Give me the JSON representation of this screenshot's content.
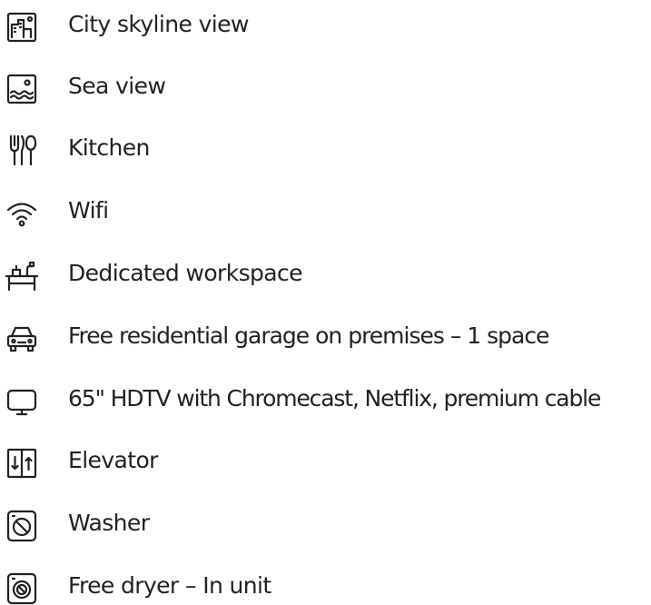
{
  "amenities": [
    {
      "label": "City skyline view",
      "icon": "city-skyline-icon"
    },
    {
      "label": "Sea view",
      "icon": "sea-view-icon"
    },
    {
      "label": "Kitchen",
      "icon": "kitchen-utensils-icon"
    },
    {
      "label": "Wifi",
      "icon": "wifi-icon"
    },
    {
      "label": "Dedicated workspace",
      "icon": "workspace-desk-icon"
    },
    {
      "label": "Free residential garage on premises – 1 space",
      "icon": "car-icon"
    },
    {
      "label": "65\" HDTV with Chromecast, Netflix, premium cable",
      "icon": "tv-icon"
    },
    {
      "label": "Elevator",
      "icon": "elevator-icon"
    },
    {
      "label": "Washer",
      "icon": "washer-icon"
    },
    {
      "label": "Free dryer – In unit",
      "icon": "dryer-icon"
    }
  ],
  "colors": {
    "text": "#222222",
    "icon_stroke": "#222222",
    "background": "#ffffff"
  }
}
